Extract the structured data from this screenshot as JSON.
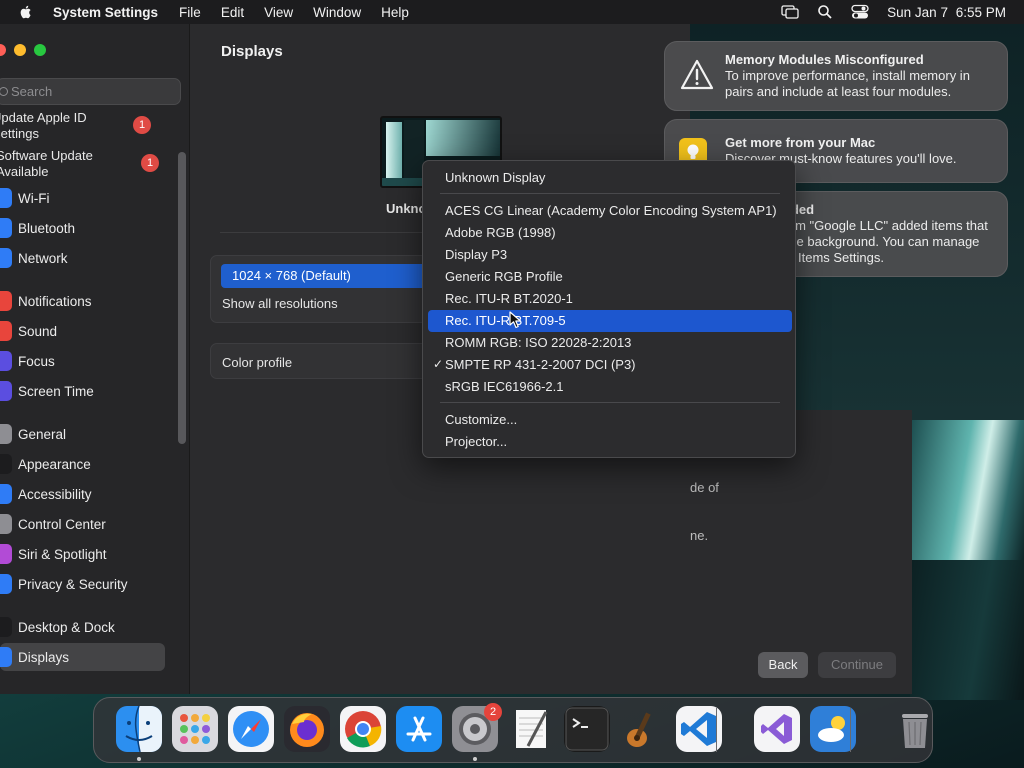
{
  "menubar": {
    "app_name": "System Settings",
    "menus": [
      "File",
      "Edit",
      "View",
      "Window",
      "Help"
    ],
    "date": "Sun Jan 7",
    "time": "6:55 PM"
  },
  "sidebar": {
    "search_placeholder": "Search",
    "alerts": [
      {
        "label_line1": "Update Apple ID",
        "label_line2": "Settings",
        "badge": "1"
      },
      {
        "label_line1": "Software Update",
        "label_line2": "Available",
        "badge": "1"
      }
    ],
    "items": [
      {
        "label": "Wi-Fi",
        "icon": "wifi-icon",
        "color": "#2f7cf6"
      },
      {
        "label": "Bluetooth",
        "icon": "bluetooth-icon",
        "color": "#2f7cf6"
      },
      {
        "label": "Network",
        "icon": "network-globe-icon",
        "color": "#2f7cf6"
      },
      {
        "label": "Notifications",
        "icon": "bell-icon",
        "color": "#e8453c"
      },
      {
        "label": "Sound",
        "icon": "speaker-icon",
        "color": "#e8453c"
      },
      {
        "label": "Focus",
        "icon": "moon-icon",
        "color": "#5b4ee0"
      },
      {
        "label": "Screen Time",
        "icon": "hourglass-icon",
        "color": "#5b4ee0"
      },
      {
        "label": "General",
        "icon": "gear-icon",
        "color": "#8e8e93"
      },
      {
        "label": "Appearance",
        "icon": "appearance-icon",
        "color": "#1c1c1e"
      },
      {
        "label": "Accessibility",
        "icon": "accessibility-icon",
        "color": "#2f7cf6"
      },
      {
        "label": "Control Center",
        "icon": "control-center-icon",
        "color": "#8e8e93"
      },
      {
        "label": "Siri & Spotlight",
        "icon": "siri-icon",
        "color": "#b24bd6"
      },
      {
        "label": "Privacy & Security",
        "icon": "hand-icon",
        "color": "#2f7cf6"
      },
      {
        "label": "Desktop & Dock",
        "icon": "dock-icon",
        "color": "#1c1c1e"
      },
      {
        "label": "Displays",
        "icon": "display-icon",
        "color": "#2f7cf6",
        "active": true
      }
    ]
  },
  "displays": {
    "title": "Displays",
    "display_name": "Unkno",
    "resolution_selected": "1024 × 768 (Default)",
    "show_all_resolutions": "Show all resolutions",
    "color_profile_label": "Color profile"
  },
  "color_profile_menu": {
    "header": "Unknown Display",
    "items": [
      {
        "label": "ACES CG Linear (Academy Color Encoding System AP1)"
      },
      {
        "label": "Adobe RGB (1998)"
      },
      {
        "label": "Display P3"
      },
      {
        "label": "Generic RGB Profile"
      },
      {
        "label": "Rec. ITU-R BT.2020-1"
      },
      {
        "label": "Rec. ITU-R BT.709-5",
        "highlighted": true
      },
      {
        "label": "ROMM RGB: ISO 22028-2:2013"
      },
      {
        "label": "SMPTE RP 431-2-2007 DCI (P3)",
        "checked": true
      },
      {
        "label": "sRGB IEC61966-2.1"
      }
    ],
    "footer_items": [
      "Customize...",
      "Projector..."
    ]
  },
  "notifications": [
    {
      "title": "Memory Modules Misconfigured",
      "body": "To improve performance, install memory in pairs and include at least four modules.",
      "icon": "warning-icon"
    },
    {
      "title": "Get more from your Mac",
      "body": "Discover must-know features you'll love.",
      "icon": "lightbulb-icon"
    },
    {
      "title": "d Items Added",
      "body": "Software from \"Google LLC\" added items that can run in the background. You can manage this in Login Items Settings.",
      "icon": "login-items-icon"
    }
  ],
  "setup_window": {
    "text_fragment_1": "de of",
    "text_fragment_2": "ne.",
    "back_label": "Back",
    "continue_label": "Continue"
  },
  "dock": {
    "apps": [
      {
        "name": "Finder",
        "icon": "finder-icon",
        "running": true
      },
      {
        "name": "Launchpad",
        "icon": "launchpad-icon"
      },
      {
        "name": "Safari",
        "icon": "safari-icon"
      },
      {
        "name": "Firefox",
        "icon": "firefox-icon"
      },
      {
        "name": "Chrome",
        "icon": "chrome-icon"
      },
      {
        "name": "App Store",
        "icon": "app-store-icon"
      },
      {
        "name": "System Settings",
        "icon": "system-settings-icon",
        "running": true,
        "badge": "2"
      },
      {
        "name": "TextEdit",
        "icon": "textedit-icon"
      },
      {
        "name": "Terminal",
        "icon": "terminal-icon"
      },
      {
        "name": "Instruments",
        "icon": "instruments-icon"
      },
      {
        "name": "Visual Studio Code",
        "icon": "vscode-icon"
      },
      {
        "name": "Visual Studio",
        "icon": "visual-studio-icon"
      },
      {
        "name": "Weather",
        "icon": "weather-icon"
      },
      {
        "name": "Trash",
        "icon": "trash-icon"
      }
    ]
  }
}
